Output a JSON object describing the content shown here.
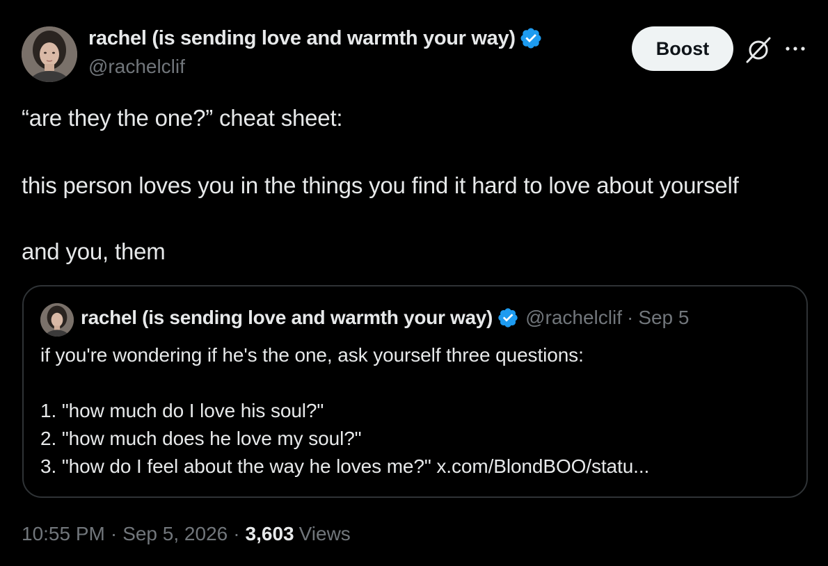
{
  "author": {
    "display_name": "rachel (is sending love and warmth your way)",
    "handle": "@rachelclif",
    "verified_color": "#1d9bf0"
  },
  "actions": {
    "boost_label": "Boost",
    "grok_icon": "grok-icon",
    "more_icon": "more-icon"
  },
  "tweet": {
    "lines": [
      "“are they the one?” cheat sheet:",
      "this person loves you in the things you find it hard to love about yourself",
      "and you, them"
    ]
  },
  "quote": {
    "display_name": "rachel (is sending love and warmth your way)",
    "handle": "@rachelclif",
    "separator": "·",
    "date": "Sep 5",
    "lines": [
      "if you're wondering if he's the one, ask yourself three questions:",
      "1. \"how much do I love his soul?\"",
      "2. \"how much does he love my soul?\"",
      "3. \"how do I feel about the way he loves me?\" x.com/BlondBOO/statu..."
    ]
  },
  "meta": {
    "time": "10:55 PM",
    "separator": "·",
    "date": "Sep 5, 2026",
    "views_count": "3,603",
    "views_label": "Views"
  },
  "colors": {
    "background": "#000000",
    "text": "#e7e9ea",
    "muted": "#71767b",
    "border": "#2f3336",
    "verified": "#1d9bf0"
  }
}
